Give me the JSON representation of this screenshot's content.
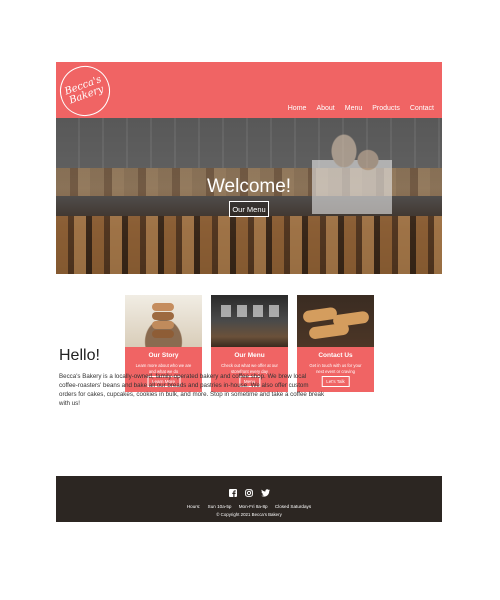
{
  "header": {
    "logo": {
      "line1": "Becca's",
      "line2": "Bakery"
    },
    "nav": [
      "Home",
      "About",
      "Menu",
      "Products",
      "Contact"
    ]
  },
  "hero": {
    "title": "Welcome!",
    "button_label": "Our Menu"
  },
  "cards": [
    {
      "title": "Our Story",
      "text": "Learn more about who we are and what we do",
      "button_label": "Learn More"
    },
    {
      "title": "Our Menu",
      "text": "Check out what we offer at our storefront every day",
      "button_label": "Menu"
    },
    {
      "title": "Contact Us",
      "text": "Get in touch with us for your next event or craving",
      "button_label": "Let's Talk"
    }
  ],
  "hello": {
    "heading": "Hello!",
    "body": "Becca's Bakery is a locally-owned, family-operated bakery and coffee shop. We brew local coffee-roasters' beans and bake all our breads and pastries in-house. We also offer custom orders for cakes, cupcakes, cookies in bulk, and more. Stop in sometime and take a coffee break with us!"
  },
  "footer": {
    "social_icons": [
      "facebook-icon",
      "instagram-icon",
      "twitter-icon"
    ],
    "hours_label": "Hours:",
    "hours": [
      "Sun 10a-5p",
      "Mon-Fri 8a-8p",
      "Closed Saturdays"
    ],
    "copyright": "© Copyright 2021 Becca's Bakery"
  },
  "colors": {
    "brand": "#f06464",
    "footer": "#2c2622",
    "text_on_brand": "#ffffff"
  }
}
